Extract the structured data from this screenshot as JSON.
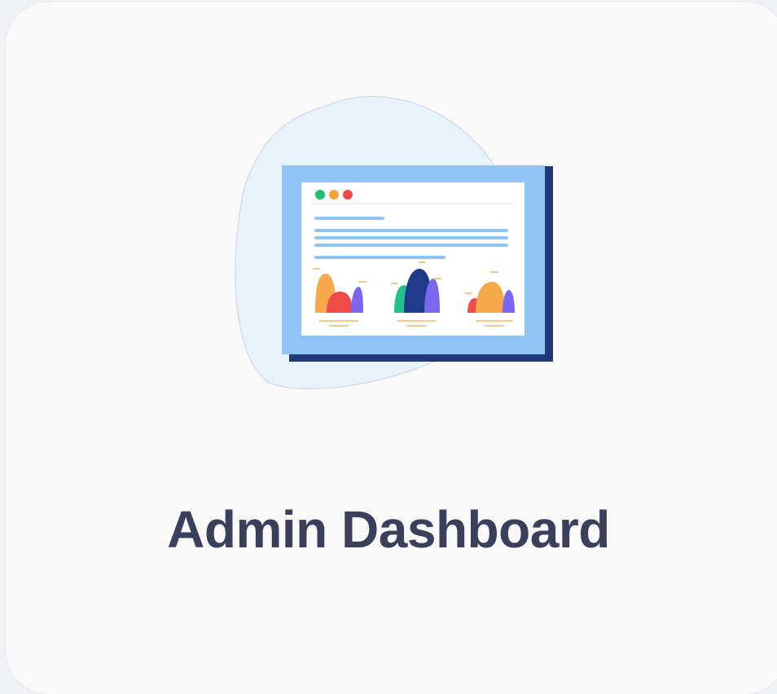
{
  "card": {
    "title": "Admin Dashboard",
    "illustration_icon": "dashboard-window-illustration"
  },
  "colors": {
    "title": "#3a3f5c",
    "blob": "#e9f1fb",
    "window_frame": "#90c4f5",
    "window_shadow": "#1f3a7a",
    "window_content": "#ffffff",
    "text_lines": "#90c4f5",
    "dot_green": "#1fbf73",
    "dot_orange": "#f7a23c",
    "dot_red": "#f04a4a",
    "chart_orange": "#f7a84a",
    "chart_red": "#f04a4a",
    "chart_purple": "#7b66f0",
    "chart_green": "#1fc38a",
    "chart_navy": "#1e3a8a"
  }
}
